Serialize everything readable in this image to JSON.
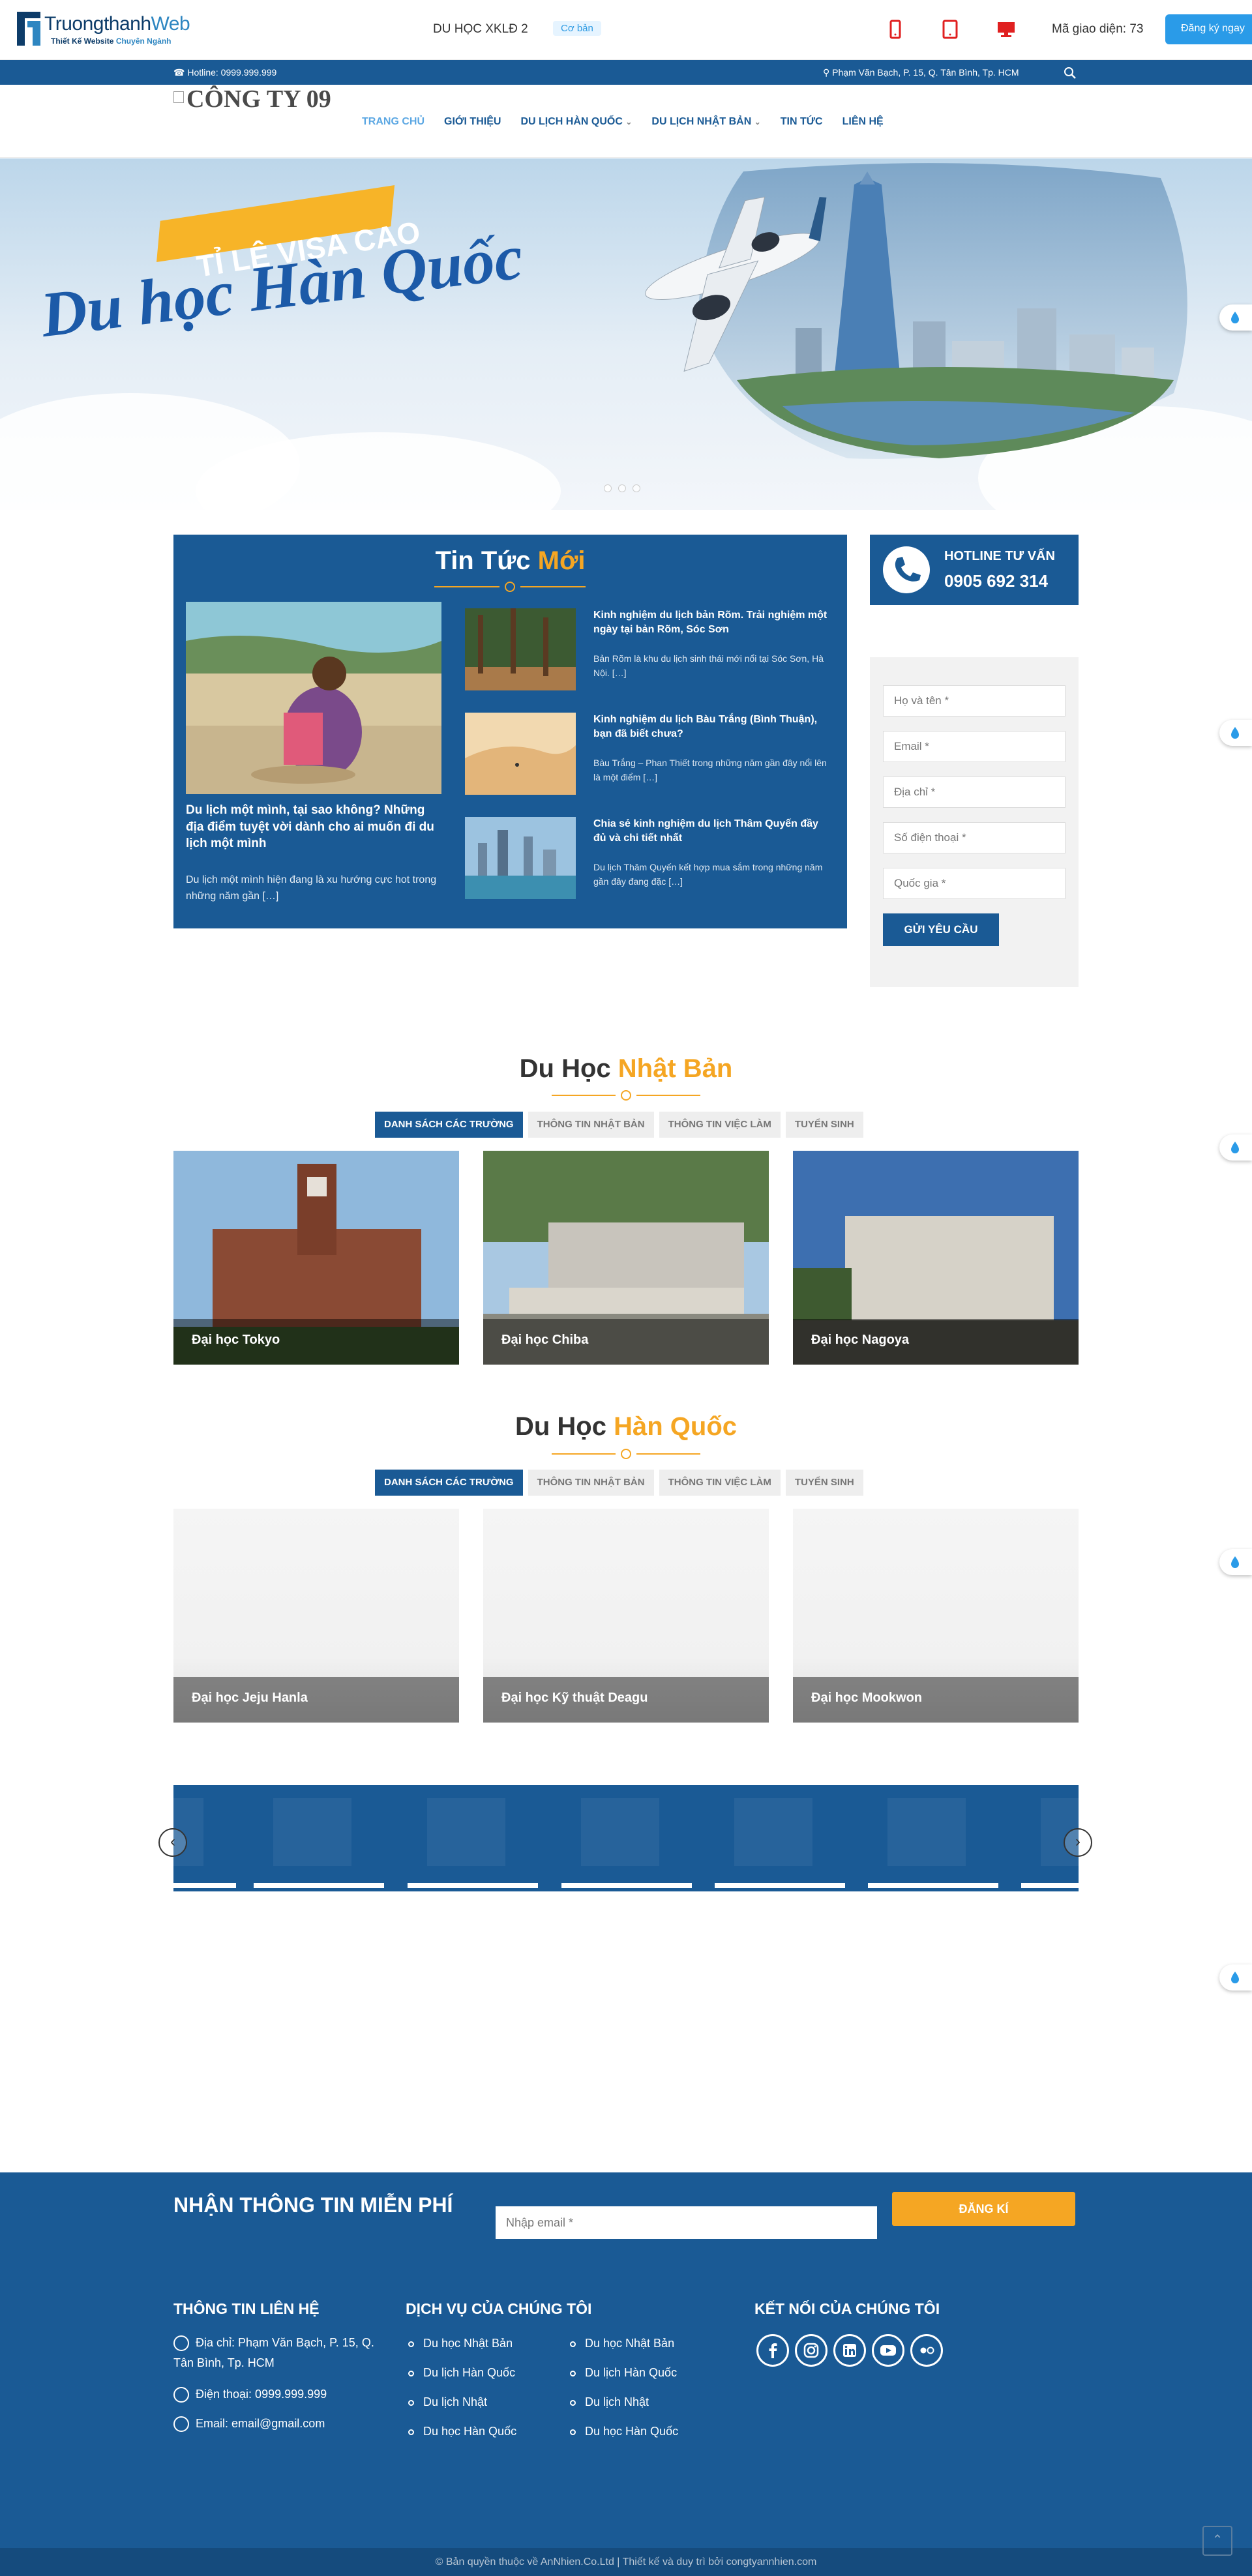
{
  "topbar": {
    "logo_main": "Truongthanh",
    "logo_accent": "Web",
    "logo_sub": "Thiết Kế Website",
    "logo_sub_accent": "Chuyên Ngành",
    "project_name": "DU HỌC XKLĐ 2",
    "tier_badge": "Cơ bản",
    "code_label": "Mã giao diện: 73",
    "register_label": "Đăng ký ngay"
  },
  "infobar": {
    "hotline": "Hotline: 0999.999.999",
    "address": "Phạm Văn Bạch, P. 15, Q. Tân Bình, Tp. HCM"
  },
  "nav": {
    "brand_alt": "CÔNG TY 09",
    "items": [
      {
        "label": "TRANG CHỦ"
      },
      {
        "label": "GIỚI THIỆU"
      },
      {
        "label": "DU LỊCH HÀN QUỐC"
      },
      {
        "label": "DU LỊCH NHẬT BẢN"
      },
      {
        "label": "TIN TỨC"
      },
      {
        "label": "LIÊN HỆ"
      }
    ]
  },
  "hero": {
    "badge": "TỈ LỆ VISA CAO",
    "title": "Du học Hàn Quốc"
  },
  "news": {
    "title_main": "Tin Tức",
    "title_accent": "Mới",
    "featured": {
      "title": "Du lịch một mình, tại sao không? Những địa điểm tuyệt vời dành cho ai muốn đi du lịch một mình",
      "desc": "Du lịch một mình hiện đang là xu hướng cực hot trong những năm gần […]"
    },
    "items": [
      {
        "title": "Kinh nghiệm du lịch bản Rõm. Trải nghiệm một ngày tại bản Rõm, Sóc Sơn",
        "desc": "Bản Rõm là khu du lịch sinh thái mới nổi tại Sóc Sơn, Hà Nội. […]"
      },
      {
        "title": "Kinh nghiệm du lịch Bàu Trắng (Bình Thuận), bạn đã biết chưa?",
        "desc": "Bàu Trắng – Phan Thiết trong những năm gần đây nổi lên là một điểm […]"
      },
      {
        "title": "Chia sẻ kinh nghiệm du lịch Thâm Quyến đầy đủ và chi tiết nhất",
        "desc": "Du lịch Thâm Quyến kết hợp mua sắm trong những năm gần đây đang đặc […]"
      }
    ]
  },
  "hotline_box": {
    "label": "HOTLINE TƯ VẤN",
    "number": "0905 692 314"
  },
  "form": {
    "fields": [
      {
        "placeholder": "Họ và tên *"
      },
      {
        "placeholder": "Email *"
      },
      {
        "placeholder": "Địa chỉ *"
      },
      {
        "placeholder": "Số điện thoại *"
      },
      {
        "placeholder": "Quốc gia *"
      }
    ],
    "submit": "GỬI YÊU CẦU"
  },
  "japan": {
    "title_main": "Du Học",
    "title_accent": "Nhật Bản",
    "tabs": [
      "DANH SÁCH CÁC TRƯỜNG",
      "THÔNG TIN NHẬT BẢN",
      "THÔNG TIN VIỆC LÀM",
      "TUYỂN SINH"
    ],
    "cards": [
      {
        "name": "Đại học Tokyo"
      },
      {
        "name": "Đại học Chiba"
      },
      {
        "name": "Đại học Nagoya"
      }
    ]
  },
  "korea": {
    "title_main": "Du Học",
    "title_accent": "Hàn Quốc",
    "tabs": [
      "DANH SÁCH CÁC TRƯỜNG",
      "THÔNG TIN NHẬT BẢN",
      "THÔNG TIN VIỆC LÀM",
      "TUYỂN SINH"
    ],
    "cards": [
      {
        "name": "Đại học Jeju Hanla"
      },
      {
        "name": "Đại học Kỹ thuật Deagu"
      },
      {
        "name": "Đại học Mookwon"
      }
    ]
  },
  "newsletter": {
    "title": "NHẬN THÔNG TIN MIỄN PHÍ",
    "placeholder": "Nhập email *",
    "button": "ĐĂNG KÍ"
  },
  "footer": {
    "contact_title": "THÔNG TIN LIÊN HỆ",
    "address": "Địa chỉ: Phạm Văn Bạch, P. 15, Q. Tân Bình, Tp. HCM",
    "phone": "Điện thoại: 0999.999.999",
    "email": "Email: email@gmail.com",
    "services_title": "DỊCH VỤ CỦA CHÚNG TÔI",
    "services_col1": [
      "Du học Nhật Bản",
      "Du lịch Hàn Quốc",
      "Du lịch Nhật",
      "Du học Hàn Quốc"
    ],
    "services_col2": [
      "Du học Nhật Bản",
      "Du lịch Hàn Quốc",
      "Du lịch Nhật",
      "Du học Hàn Quốc"
    ],
    "social_title": "KẾT NỐI CỦA CHÚNG TÔI",
    "social_icons": [
      "facebook-icon",
      "instagram-icon",
      "linkedin-icon",
      "youtube-icon",
      "flickr-icon"
    ],
    "copyright": "© Bản quyền thuộc về AnNhien.Co.Ltd | Thiết kế và duy trì bởi congtyannhien.com"
  },
  "colors": {
    "primary": "#1a5a95",
    "accent": "#f5a623",
    "register": "#2a9be8"
  }
}
